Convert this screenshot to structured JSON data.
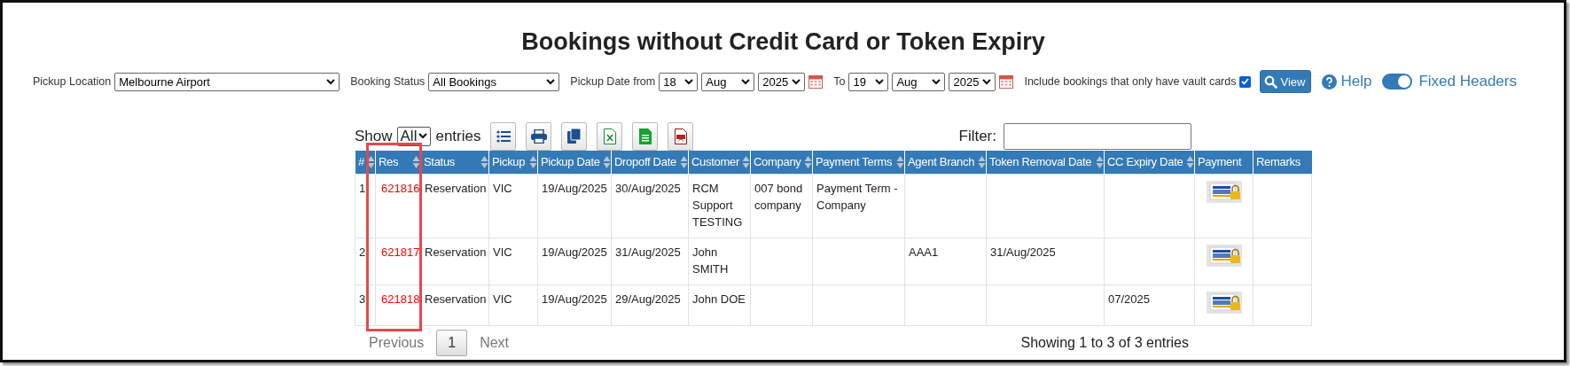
{
  "title": "Bookings without Credit Card or Token Expiry",
  "filters": {
    "pickup_location": {
      "label": "Pickup Location",
      "value": "Melbourne Airport"
    },
    "booking_status": {
      "label": "Booking Status",
      "value": "All Bookings"
    },
    "pickup_date_from": {
      "label": "Pickup Date from",
      "day": "18",
      "month": "Aug",
      "year": "2025"
    },
    "pickup_date_to": {
      "label": "To",
      "day": "19",
      "month": "Aug",
      "year": "2025"
    },
    "vault_cards": {
      "label": "Include bookings that only have vault cards",
      "checked": true
    },
    "view_button": "View",
    "help_link": "Help",
    "fixed_headers": {
      "label": "Fixed Headers",
      "on": true
    }
  },
  "table_controls": {
    "show_label": "Show",
    "page_length": "All",
    "entries_label": "entries",
    "buttons": [
      {
        "kind": "columns"
      },
      {
        "kind": "print"
      },
      {
        "kind": "copy"
      },
      {
        "kind": "excel"
      },
      {
        "kind": "csv"
      },
      {
        "kind": "pdf"
      }
    ],
    "filter_label": "Filter:"
  },
  "table": {
    "columns": [
      {
        "label": "#",
        "sortable": true,
        "highlighted": false
      },
      {
        "label": "Res",
        "sortable": true,
        "highlighted": true
      },
      {
        "label": "Status",
        "sortable": true,
        "highlighted": false
      },
      {
        "label": "Pickup",
        "sortable": true,
        "highlighted": false
      },
      {
        "label": "Pickup Date",
        "sortable": true,
        "highlighted": false
      },
      {
        "label": "Dropoff Date",
        "sortable": true,
        "highlighted": false
      },
      {
        "label": "Customer",
        "sortable": true,
        "highlighted": false
      },
      {
        "label": "Company",
        "sortable": true,
        "highlighted": false
      },
      {
        "label": "Payment Terms",
        "sortable": true,
        "highlighted": false
      },
      {
        "label": "Agent Branch",
        "sortable": true,
        "highlighted": false
      },
      {
        "label": "Token Removal Date",
        "sortable": true,
        "highlighted": false
      },
      {
        "label": "CC Expiry Date",
        "sortable": true,
        "highlighted": false
      },
      {
        "label": "Payment",
        "sortable": false,
        "highlighted": false
      },
      {
        "label": "Remarks",
        "sortable": false,
        "highlighted": false
      }
    ],
    "rows": [
      {
        "cells": [
          "1",
          "621816",
          "Reservation",
          "VIC",
          "19/Aug/2025",
          "30/Aug/2025",
          "RCM Support TESTING",
          "007 bond company",
          "Payment Term - Company",
          null,
          null,
          null
        ],
        "card_on_file": true
      },
      {
        "cells": [
          "2",
          "621817",
          "Reservation",
          "VIC",
          "19/Aug/2025",
          "31/Aug/2025",
          "John SMITH",
          null,
          null,
          "AAA1",
          "31/Aug/2025",
          null
        ],
        "card_on_file": true
      },
      {
        "cells": [
          "3",
          "621818",
          "Reservation",
          "VIC",
          "19/Aug/2025",
          "29/Aug/2025",
          "John DOE",
          null,
          null,
          null,
          null,
          "07/2025"
        ],
        "card_on_file": true
      }
    ]
  },
  "pagination": {
    "previous": {
      "label": "Previous",
      "disabled": true
    },
    "pages": [
      {
        "label": "1",
        "selected": true
      }
    ],
    "next": {
      "label": "Next",
      "disabled": true
    }
  },
  "info": "Showing 1 to 3 of 3 entries"
}
